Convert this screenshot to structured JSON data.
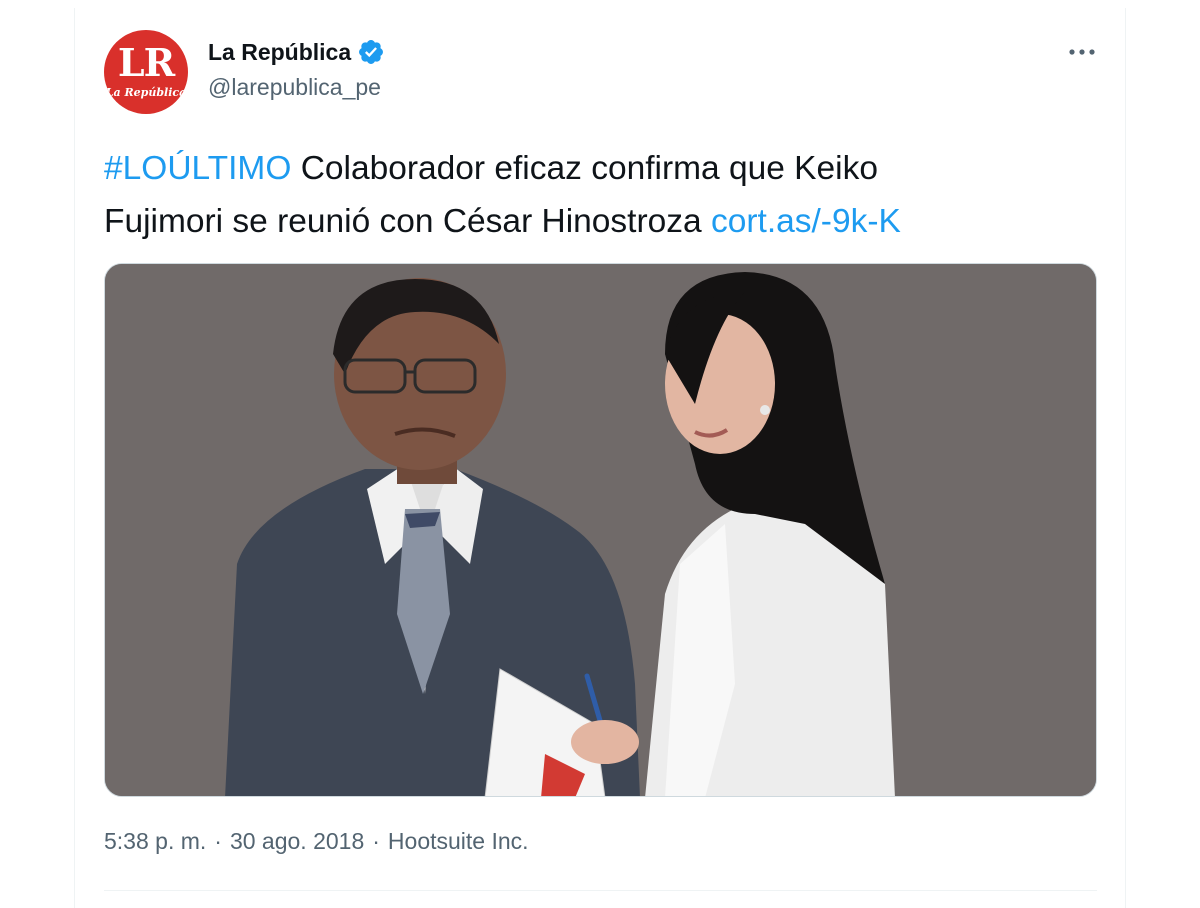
{
  "account": {
    "display_name": "La República",
    "handle": "@larepublica_pe",
    "avatar_text": "LR",
    "avatar_subtext": "La República",
    "verified": true
  },
  "tweet": {
    "hashtag": "#LOÚLTIMO",
    "text_1": " Colaborador eficaz confirma que Keiko",
    "text_2": "Fujimori se reunió con César Hinostroza ",
    "link": "cort.as/-9k-K"
  },
  "meta": {
    "time": "5:38 p. m.",
    "sep": "·",
    "date": "30 ago. 2018",
    "source": "Hootsuite Inc."
  },
  "colors": {
    "link": "#1d9bf0",
    "verified": "#1d9bf0",
    "avatar_bg": "#d9302b",
    "media_bg": "#706a69",
    "secondary_text": "#536471"
  },
  "icons": {
    "verified": "verified-badge-icon",
    "more": "more-options-icon"
  }
}
